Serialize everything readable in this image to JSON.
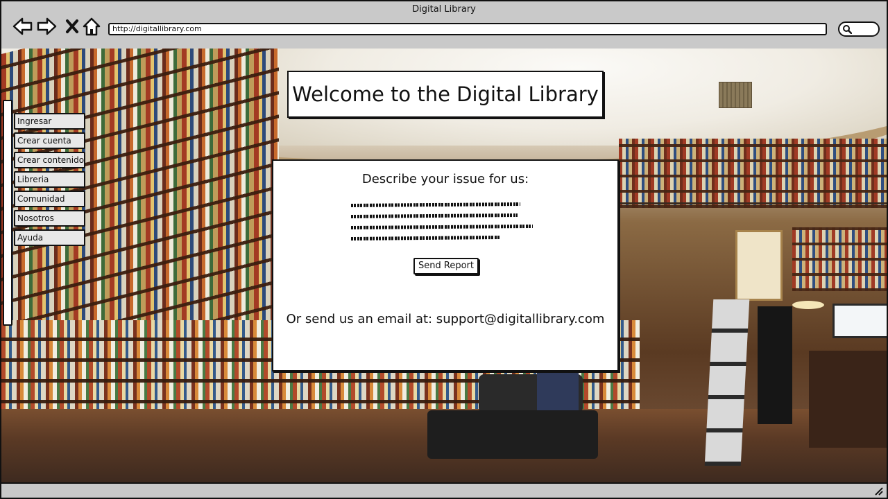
{
  "window": {
    "title": "Digital Library"
  },
  "browser": {
    "url": "http://digitallibrary.com",
    "icons": [
      "back-arrow-icon",
      "forward-arrow-icon",
      "close-x-icon",
      "home-icon",
      "search-icon"
    ]
  },
  "sidebar": {
    "items": [
      {
        "label": "Ingresar"
      },
      {
        "label": "Crear cuenta"
      },
      {
        "label": "Crear contenido"
      },
      {
        "label": "Libreria"
      },
      {
        "label": "Comunidad"
      },
      {
        "label": "Nosotros"
      },
      {
        "label": "Ayuda"
      }
    ]
  },
  "main": {
    "heading": "Welcome to the Digital Library",
    "report": {
      "prompt": "Describe your issue for us:",
      "send_label": "Send Report",
      "email_text": "Or send us an email at: support@digitallibrary.com"
    }
  },
  "colors": {
    "chrome": "#c9c9c9",
    "ink": "#111111",
    "panel": "#ffffff"
  }
}
